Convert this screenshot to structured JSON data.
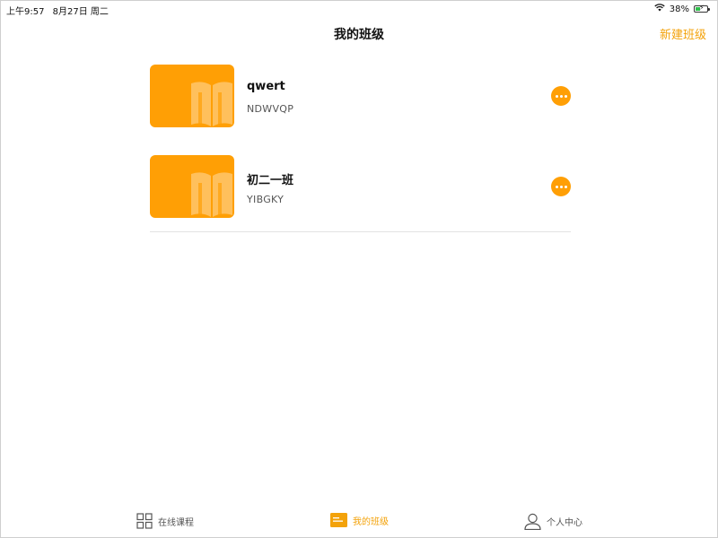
{
  "status_bar": {
    "time": "上午9:57",
    "date": "8月27日 周二",
    "battery": "38%",
    "battery_level": 0.38,
    "icons": [
      "wifi-icon",
      "battery-icon"
    ]
  },
  "nav": {
    "title": "我的班级",
    "action_label": "新建班级",
    "accent_color": "#f3a20a"
  },
  "classes": [
    {
      "name": "qwert",
      "code": "NDWVQP"
    },
    {
      "name": "初二一班",
      "code": "YIBGKY"
    }
  ],
  "tabs": [
    {
      "label": "在线课程",
      "icon": "grid-icon",
      "active": false
    },
    {
      "label": "我的班级",
      "icon": "class-list-icon",
      "active": true
    },
    {
      "label": "个人中心",
      "icon": "person-icon",
      "active": false
    }
  ],
  "colors": {
    "accent": "#f3a20a",
    "thumb": "#ff9f05"
  }
}
